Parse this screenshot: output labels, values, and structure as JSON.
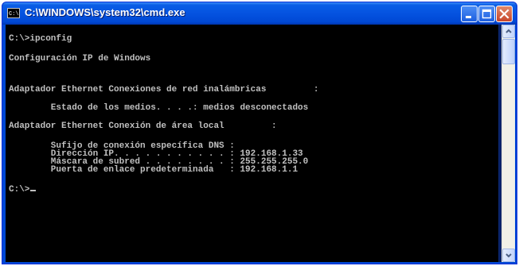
{
  "window": {
    "title": "C:\\WINDOWS\\system32\\cmd.exe",
    "icon": "cmd-icon",
    "controls": {
      "minimize": "minimize-icon",
      "maximize": "maximize-icon",
      "close": "close-icon"
    }
  },
  "console": {
    "lines": [
      "C:\\>ipconfig",
      "Configuración IP de Windows",
      "Adaptador Ethernet Conexiones de red inalámbricas         :",
      "        Estado de los medios. . . .: medios desconectados",
      "Adaptador Ethernet Conexión de área local         :",
      "        Sufijo de conexión específica DNS :",
      "        Dirección IP. . . . . . . . . . . : 192.168.1.33",
      "        Máscara de subred . . . . . . . . : 255.255.255.0",
      "        Puerta de enlace predeterminada   : 192.168.1.1",
      "C:\\>"
    ]
  },
  "colors": {
    "titlebar": "#0553e0",
    "console_bg": "#000000",
    "console_text": "#c0c0c0"
  }
}
